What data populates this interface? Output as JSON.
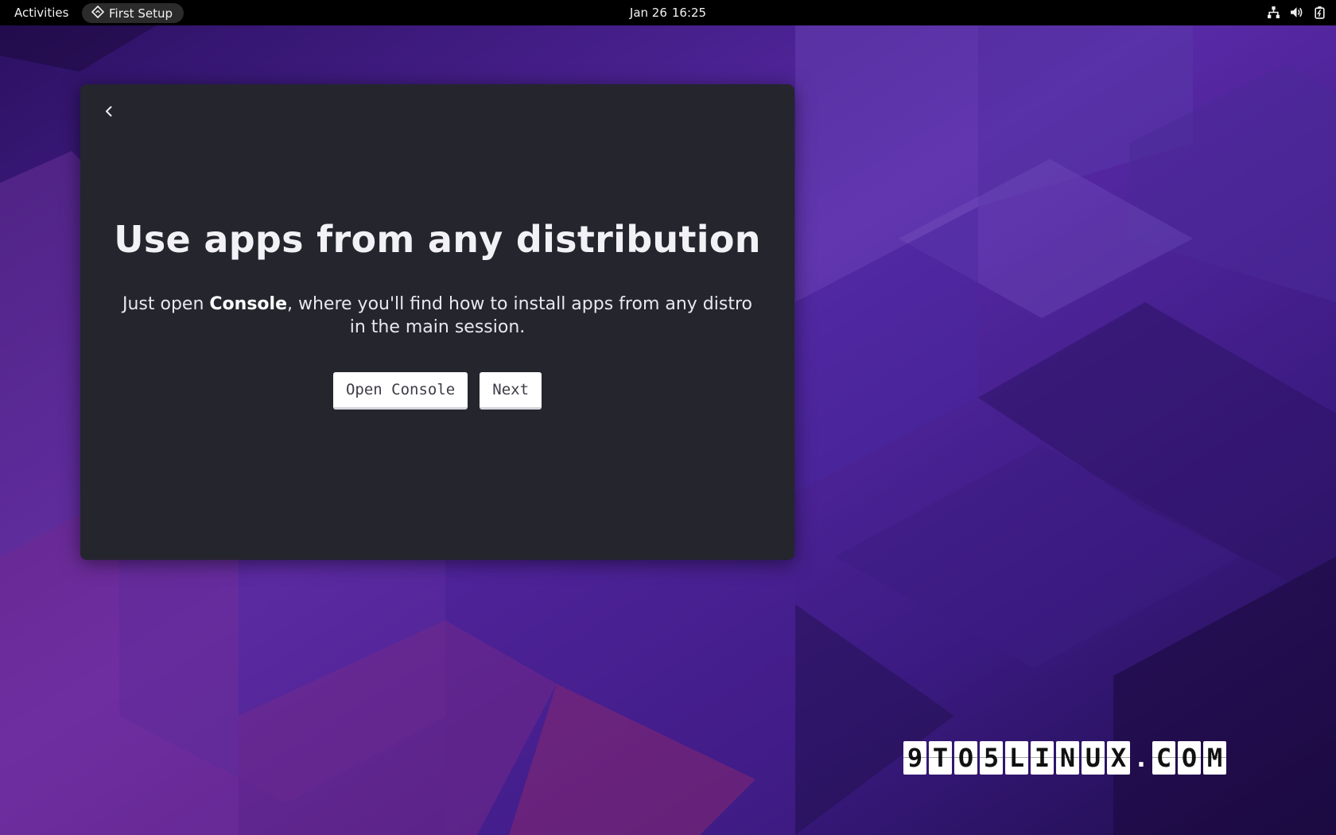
{
  "topbar": {
    "activities_label": "Activities",
    "app_name": "First Setup",
    "app_icon": "setup-diamond-icon",
    "date": "Jan 26",
    "time": "16:25",
    "tray_icons": [
      "network-wired-icon",
      "volume-icon",
      "battery-icon"
    ]
  },
  "dialog": {
    "back_icon": "chevron-left-icon",
    "title": "Use apps from any distribution",
    "subtitle_prefix": "Just open ",
    "subtitle_bold": "Console",
    "subtitle_suffix": ", where you'll find how to install apps from any distro in the main session.",
    "open_console_label": "Open Console",
    "next_label": "Next"
  },
  "watermark": {
    "chars": [
      "9",
      "T",
      "O",
      "5",
      "L",
      "I",
      "N",
      "U",
      "X",
      ".",
      "C",
      "O",
      "M"
    ]
  },
  "colors": {
    "topbar_bg": "#000000",
    "dialog_bg": "#25252e",
    "wallpaper_base": "#3a1a78",
    "button_bg": "#ffffff"
  }
}
